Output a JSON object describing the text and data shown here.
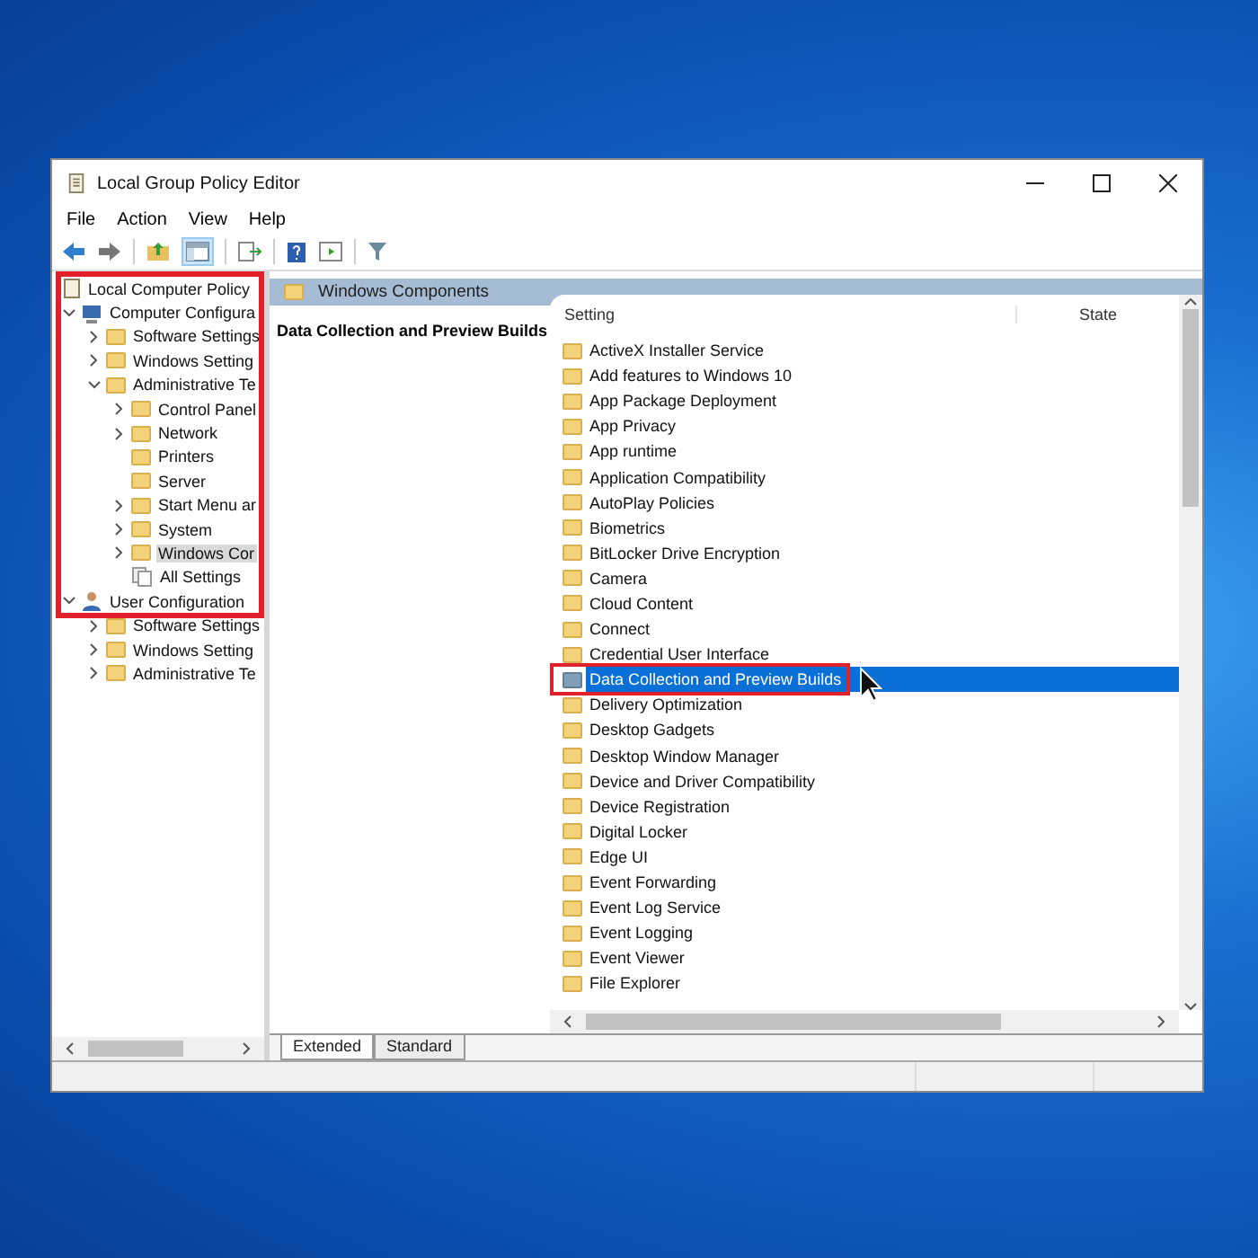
{
  "window": {
    "title": "Local Group Policy Editor"
  },
  "menu": [
    "File",
    "Action",
    "View",
    "Help"
  ],
  "tree": [
    {
      "label": "Local Computer Policy",
      "kind": "policy",
      "children": [
        {
          "label": "Computer Configura",
          "kind": "computer",
          "expanded": true,
          "selected": false,
          "children": [
            {
              "label": "Software Settings",
              "kind": "folder",
              "expanded": false,
              "selected": false
            },
            {
              "label": "Windows Setting",
              "kind": "folder",
              "expanded": false,
              "selected": false
            },
            {
              "label": "Administrative Te",
              "kind": "folder",
              "expanded": true,
              "selected": false,
              "children": [
                {
                  "label": "Control Panel",
                  "kind": "folder",
                  "expanded": false,
                  "selected": false
                },
                {
                  "label": "Network",
                  "kind": "folder",
                  "expanded": false,
                  "selected": false
                },
                {
                  "label": "Printers",
                  "kind": "folder",
                  "selected": false
                },
                {
                  "label": "Server",
                  "kind": "folder",
                  "selected": false
                },
                {
                  "label": "Start Menu ar",
                  "kind": "folder",
                  "expanded": false,
                  "selected": false
                },
                {
                  "label": "System",
                  "kind": "folder",
                  "expanded": false,
                  "selected": false
                },
                {
                  "label": "Windows Cor",
                  "kind": "folder",
                  "expanded": false,
                  "selected": true
                },
                {
                  "label": "All Settings",
                  "kind": "settings",
                  "selected": false
                }
              ]
            }
          ]
        },
        {
          "label": "User Configuration",
          "kind": "user",
          "expanded": true,
          "selected": false,
          "children": [
            {
              "label": "Software Settings",
              "kind": "folder",
              "expanded": false,
              "selected": false
            },
            {
              "label": "Windows Setting",
              "kind": "folder",
              "expanded": false,
              "selected": false
            },
            {
              "label": "Administrative Te",
              "kind": "folder",
              "expanded": false,
              "selected": false
            }
          ]
        }
      ]
    }
  ],
  "highlight_frames": {
    "tree_panel": true,
    "selected_row": true
  },
  "header": {
    "title": "Windows Components"
  },
  "description": {
    "title": "Data Collection and Preview Builds"
  },
  "table": {
    "columns": [
      "Setting",
      "State"
    ],
    "rows": [
      {
        "name": "ActiveX Installer Service",
        "selected": false
      },
      {
        "name": "Add features to Windows 10",
        "selected": false
      },
      {
        "name": "App Package Deployment",
        "selected": false
      },
      {
        "name": "App Privacy",
        "selected": false
      },
      {
        "name": "App runtime",
        "selected": false
      },
      {
        "name": "Application Compatibility",
        "selected": false
      },
      {
        "name": "AutoPlay Policies",
        "selected": false
      },
      {
        "name": "Biometrics",
        "selected": false
      },
      {
        "name": "BitLocker Drive Encryption",
        "selected": false
      },
      {
        "name": "Camera",
        "selected": false
      },
      {
        "name": "Cloud Content",
        "selected": false
      },
      {
        "name": "Connect",
        "selected": false
      },
      {
        "name": "Credential User Interface",
        "selected": false
      },
      {
        "name": "Data Collection and Preview Builds",
        "selected": true
      },
      {
        "name": "Delivery Optimization",
        "selected": false
      },
      {
        "name": "Desktop Gadgets",
        "selected": false
      },
      {
        "name": "Desktop Window Manager",
        "selected": false
      },
      {
        "name": "Device and Driver Compatibility",
        "selected": false
      },
      {
        "name": "Device Registration",
        "selected": false
      },
      {
        "name": "Digital Locker",
        "selected": false
      },
      {
        "name": "Edge UI",
        "selected": false
      },
      {
        "name": "Event Forwarding",
        "selected": false
      },
      {
        "name": "Event Log Service",
        "selected": false
      },
      {
        "name": "Event Logging",
        "selected": false
      },
      {
        "name": "Event Viewer",
        "selected": false
      },
      {
        "name": "File Explorer",
        "selected": false
      }
    ]
  },
  "view_tabs": [
    {
      "label": "Extended",
      "selected": true
    },
    {
      "label": "Standard",
      "selected": false
    }
  ]
}
